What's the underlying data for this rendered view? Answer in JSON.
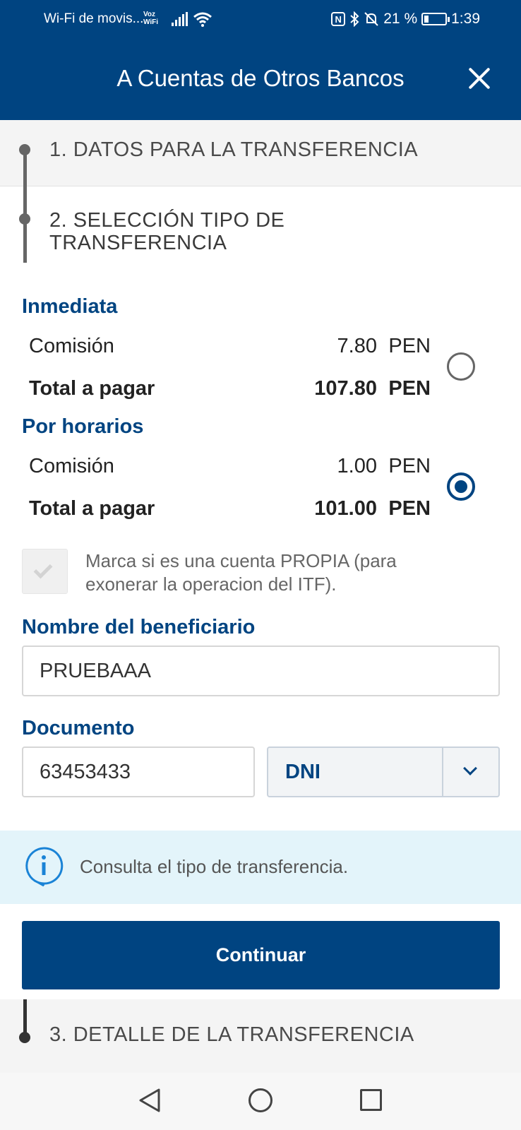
{
  "status_bar": {
    "carrier": "Wi-Fi de movis...",
    "voz_wifi_top": "Voz",
    "voz_wifi_bottom": "WiFi",
    "nfc": "N",
    "battery_percent": "21 %",
    "battery_level": 0.21,
    "time": "1:39"
  },
  "header": {
    "title": "A Cuentas de Otros Bancos",
    "close_icon": "close-icon"
  },
  "steps": {
    "step1": "1. DATOS PARA LA TRANSFERENCIA",
    "step2_line1": "2. SELECCIÓN TIPO DE",
    "step2_line2": "TRANSFERENCIA",
    "step3": "3. DETALLE DE LA TRANSFERENCIA"
  },
  "options": [
    {
      "title": "Inmediata",
      "commission_label": "Comisión",
      "commission_value": "7.80",
      "commission_currency": "PEN",
      "total_label": "Total a pagar",
      "total_value": "107.80",
      "total_currency": "PEN",
      "selected": false
    },
    {
      "title": "Por horarios",
      "commission_label": "Comisión",
      "commission_value": "1.00",
      "commission_currency": "PEN",
      "total_label": "Total a pagar",
      "total_value": "101.00",
      "total_currency": "PEN",
      "selected": true
    }
  ],
  "own_account": {
    "label_line1": "Marca si es una cuenta PROPIA (para",
    "label_line2": "exonerar la operacion del ITF).",
    "checked": false
  },
  "beneficiary": {
    "label": "Nombre del beneficiario",
    "value": "PRUEBAAA"
  },
  "document": {
    "label": "Documento",
    "number": "63453433",
    "type": "DNI",
    "icon": "chevron-down-icon"
  },
  "info": {
    "icon": "info-icon",
    "text": "Consulta el tipo de transferencia."
  },
  "actions": {
    "continue_label": "Continuar"
  },
  "navbar": {
    "icons": [
      "back-icon",
      "home-icon",
      "recent-apps-icon"
    ]
  },
  "colors": {
    "primary": "#004481",
    "info_bg": "#e3f4fa",
    "step_bg": "#f4f4f4"
  }
}
